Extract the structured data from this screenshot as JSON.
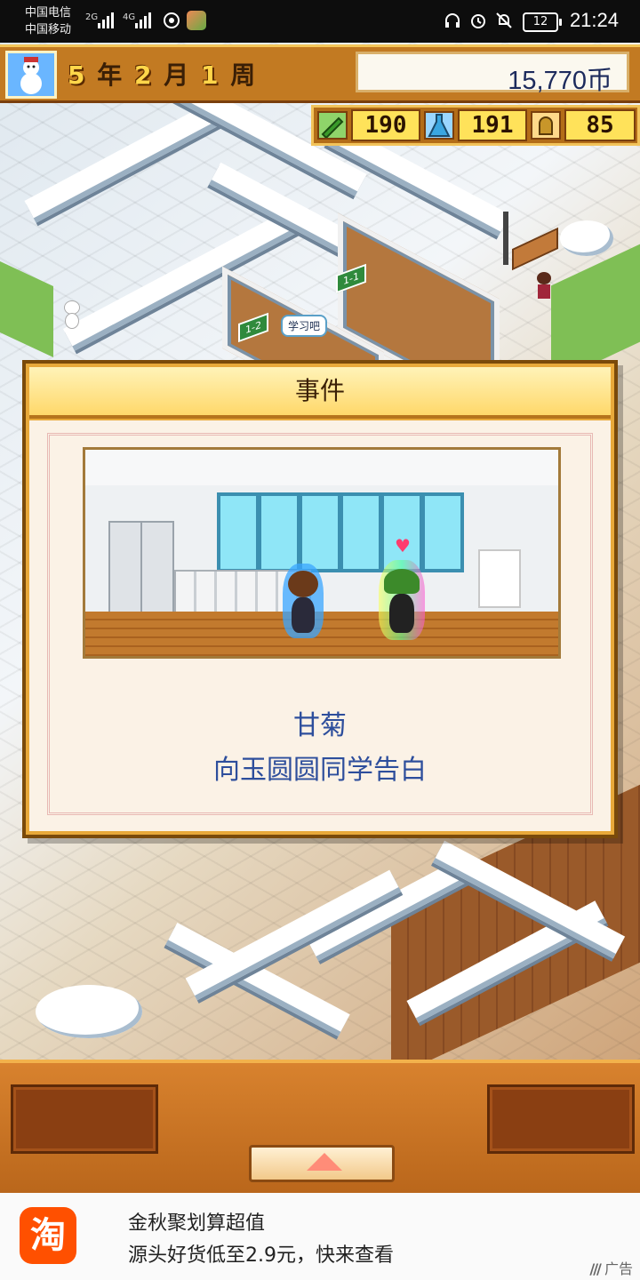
{
  "status_bar": {
    "carrier1": "中国电信",
    "carrier2": "中国移动",
    "net1": "2G",
    "net2": "4G",
    "battery": "12",
    "time": "21:24"
  },
  "hud": {
    "year": "5",
    "year_unit": "年",
    "month": "2",
    "month_unit": "月",
    "week": "1",
    "week_unit": "周",
    "money": "15,770币",
    "stats": [
      {
        "icon": "pencil-icon",
        "value": "190"
      },
      {
        "icon": "flask-icon",
        "value": "191"
      },
      {
        "icon": "bell-icon",
        "value": "85"
      }
    ]
  },
  "map": {
    "speech_bubble": "学习吧"
  },
  "dialog": {
    "title": "事件",
    "character_name": "甘菊",
    "message": "向玉圆圆同学告白"
  },
  "ad": {
    "logo_text": "淘",
    "title": "金秋聚划算超值",
    "subtitle": "源头好货低至2.9元，快来查看",
    "tag": "广告"
  },
  "colors": {
    "hud_orange": "#c27a22",
    "dialog_text": "#2d4e9c",
    "stat_yellow": "#ffe25a",
    "ad_brand": "#ff5000"
  }
}
